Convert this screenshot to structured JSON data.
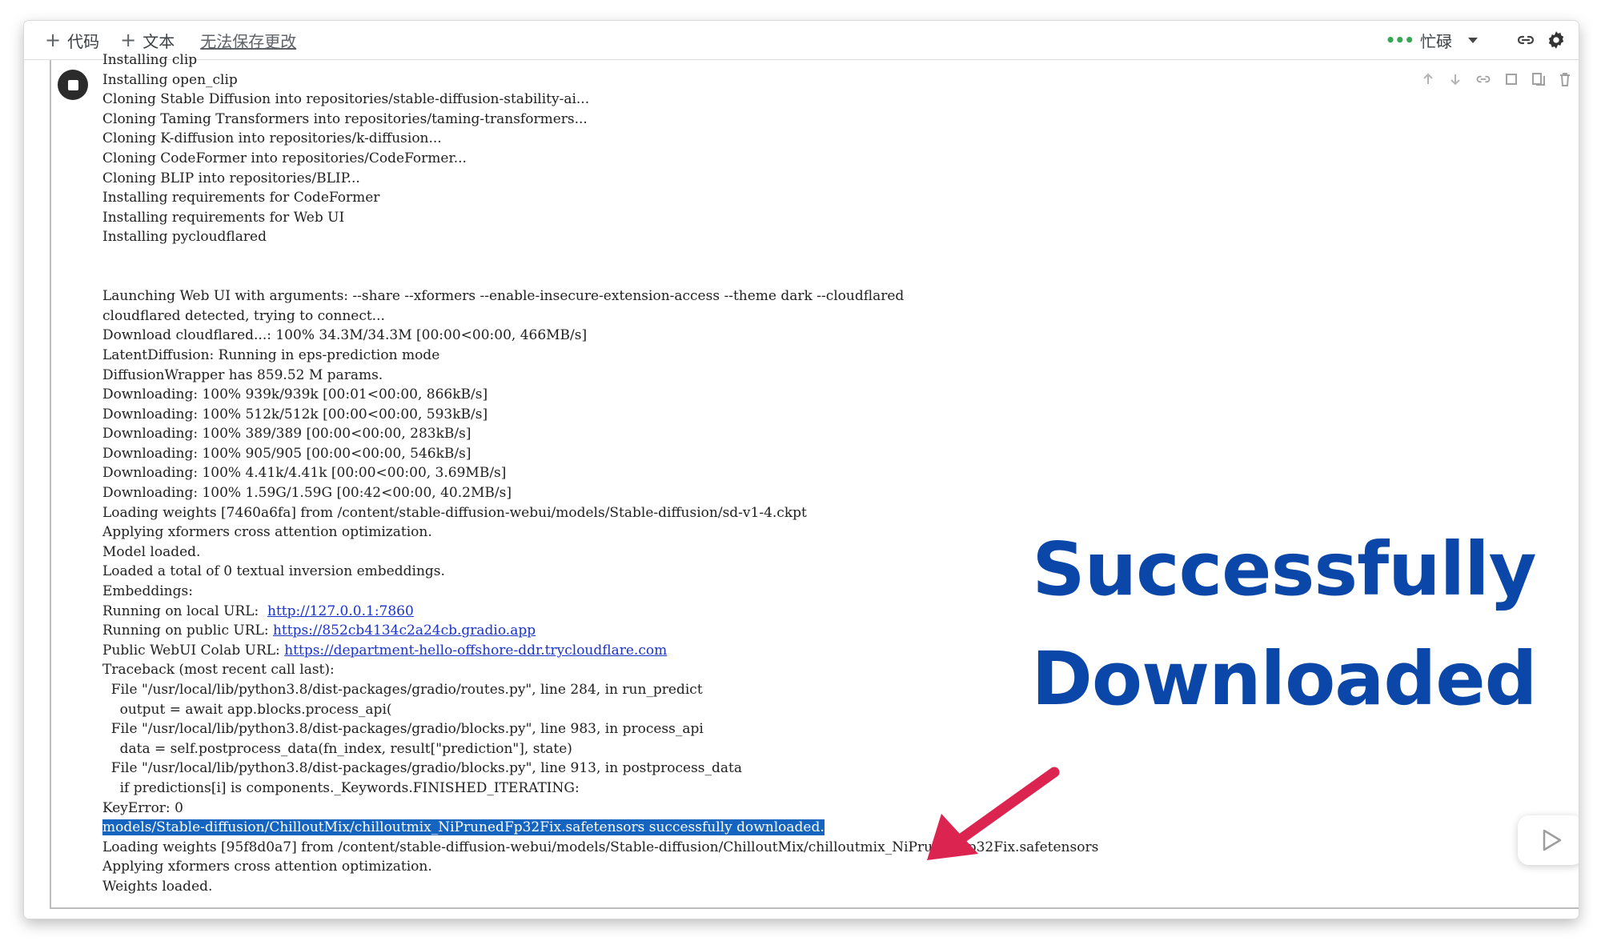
{
  "toolbar": {
    "add_code": "代码",
    "add_text": "文本",
    "save_status": "无法保存更改",
    "busy_label": "忙碌",
    "busy_dots": "•••"
  },
  "output_lines": [
    "Installing clip",
    "Installing open_clip",
    "Cloning Stable Diffusion into repositories/stable-diffusion-stability-ai...",
    "Cloning Taming Transformers into repositories/taming-transformers...",
    "Cloning K-diffusion into repositories/k-diffusion...",
    "Cloning CodeFormer into repositories/CodeFormer...",
    "Cloning BLIP into repositories/BLIP...",
    "Installing requirements for CodeFormer",
    "Installing requirements for Web UI",
    "Installing pycloudflared",
    "",
    "",
    "Launching Web UI with arguments: --share --xformers --enable-insecure-extension-access --theme dark --cloudflared",
    "cloudflared detected, trying to connect...",
    "Download cloudflared...: 100% 34.3M/34.3M [00:00<00:00, 466MB/s]",
    "LatentDiffusion: Running in eps-prediction mode",
    "DiffusionWrapper has 859.52 M params.",
    "Downloading: 100% 939k/939k [00:01<00:00, 866kB/s]",
    "Downloading: 100% 512k/512k [00:00<00:00, 593kB/s]",
    "Downloading: 100% 389/389 [00:00<00:00, 283kB/s]",
    "Downloading: 100% 905/905 [00:00<00:00, 546kB/s]",
    "Downloading: 100% 4.41k/4.41k [00:00<00:00, 3.69MB/s]",
    "Downloading: 100% 1.59G/1.59G [00:42<00:00, 40.2MB/s]",
    "Loading weights [7460a6fa] from /content/stable-diffusion-webui/models/Stable-diffusion/sd-v1-4.ckpt",
    "Applying xformers cross attention optimization.",
    "Model loaded.",
    "Loaded a total of 0 textual inversion embeddings.",
    "Embeddings:"
  ],
  "url_lines": [
    {
      "prefix": "Running on local URL:  ",
      "url": "http://127.0.0.1:7860"
    },
    {
      "prefix": "Running on public URL: ",
      "url": "https://852cb4134c2a24cb.gradio.app"
    },
    {
      "prefix": "Public WebUI Colab URL: ",
      "url": "https://department-hello-offshore-ddr.trycloudflare.com"
    }
  ],
  "traceback_lines": [
    "Traceback (most recent call last):",
    "  File \"/usr/local/lib/python3.8/dist-packages/gradio/routes.py\", line 284, in run_predict",
    "    output = await app.blocks.process_api(",
    "  File \"/usr/local/lib/python3.8/dist-packages/gradio/blocks.py\", line 983, in process_api",
    "    data = self.postprocess_data(fn_index, result[\"prediction\"], state)",
    "  File \"/usr/local/lib/python3.8/dist-packages/gradio/blocks.py\", line 913, in postprocess_data",
    "    if predictions[i] is components._Keywords.FINISHED_ITERATING:",
    "KeyError: 0"
  ],
  "highlighted_line": "models/Stable-diffusion/ChilloutMix/chilloutmix_NiPrunedFp32Fix.safetensors successfully downloaded.",
  "final_lines": [
    "Loading weights [95f8d0a7] from /content/stable-diffusion-webui/models/Stable-diffusion/ChilloutMix/chilloutmix_NiPrunedFp32Fix.safetensors",
    "Applying xformers cross attention optimization.",
    "Weights loaded."
  ],
  "overlay": {
    "line1": "Successfully",
    "line2": "Downloaded",
    "color": "#0b47a8",
    "arrow_color": "#dc2451"
  },
  "icons": [
    "plus-icon",
    "link-icon",
    "gear-icon",
    "stop-icon",
    "play-icon",
    "arrow-annotation"
  ]
}
